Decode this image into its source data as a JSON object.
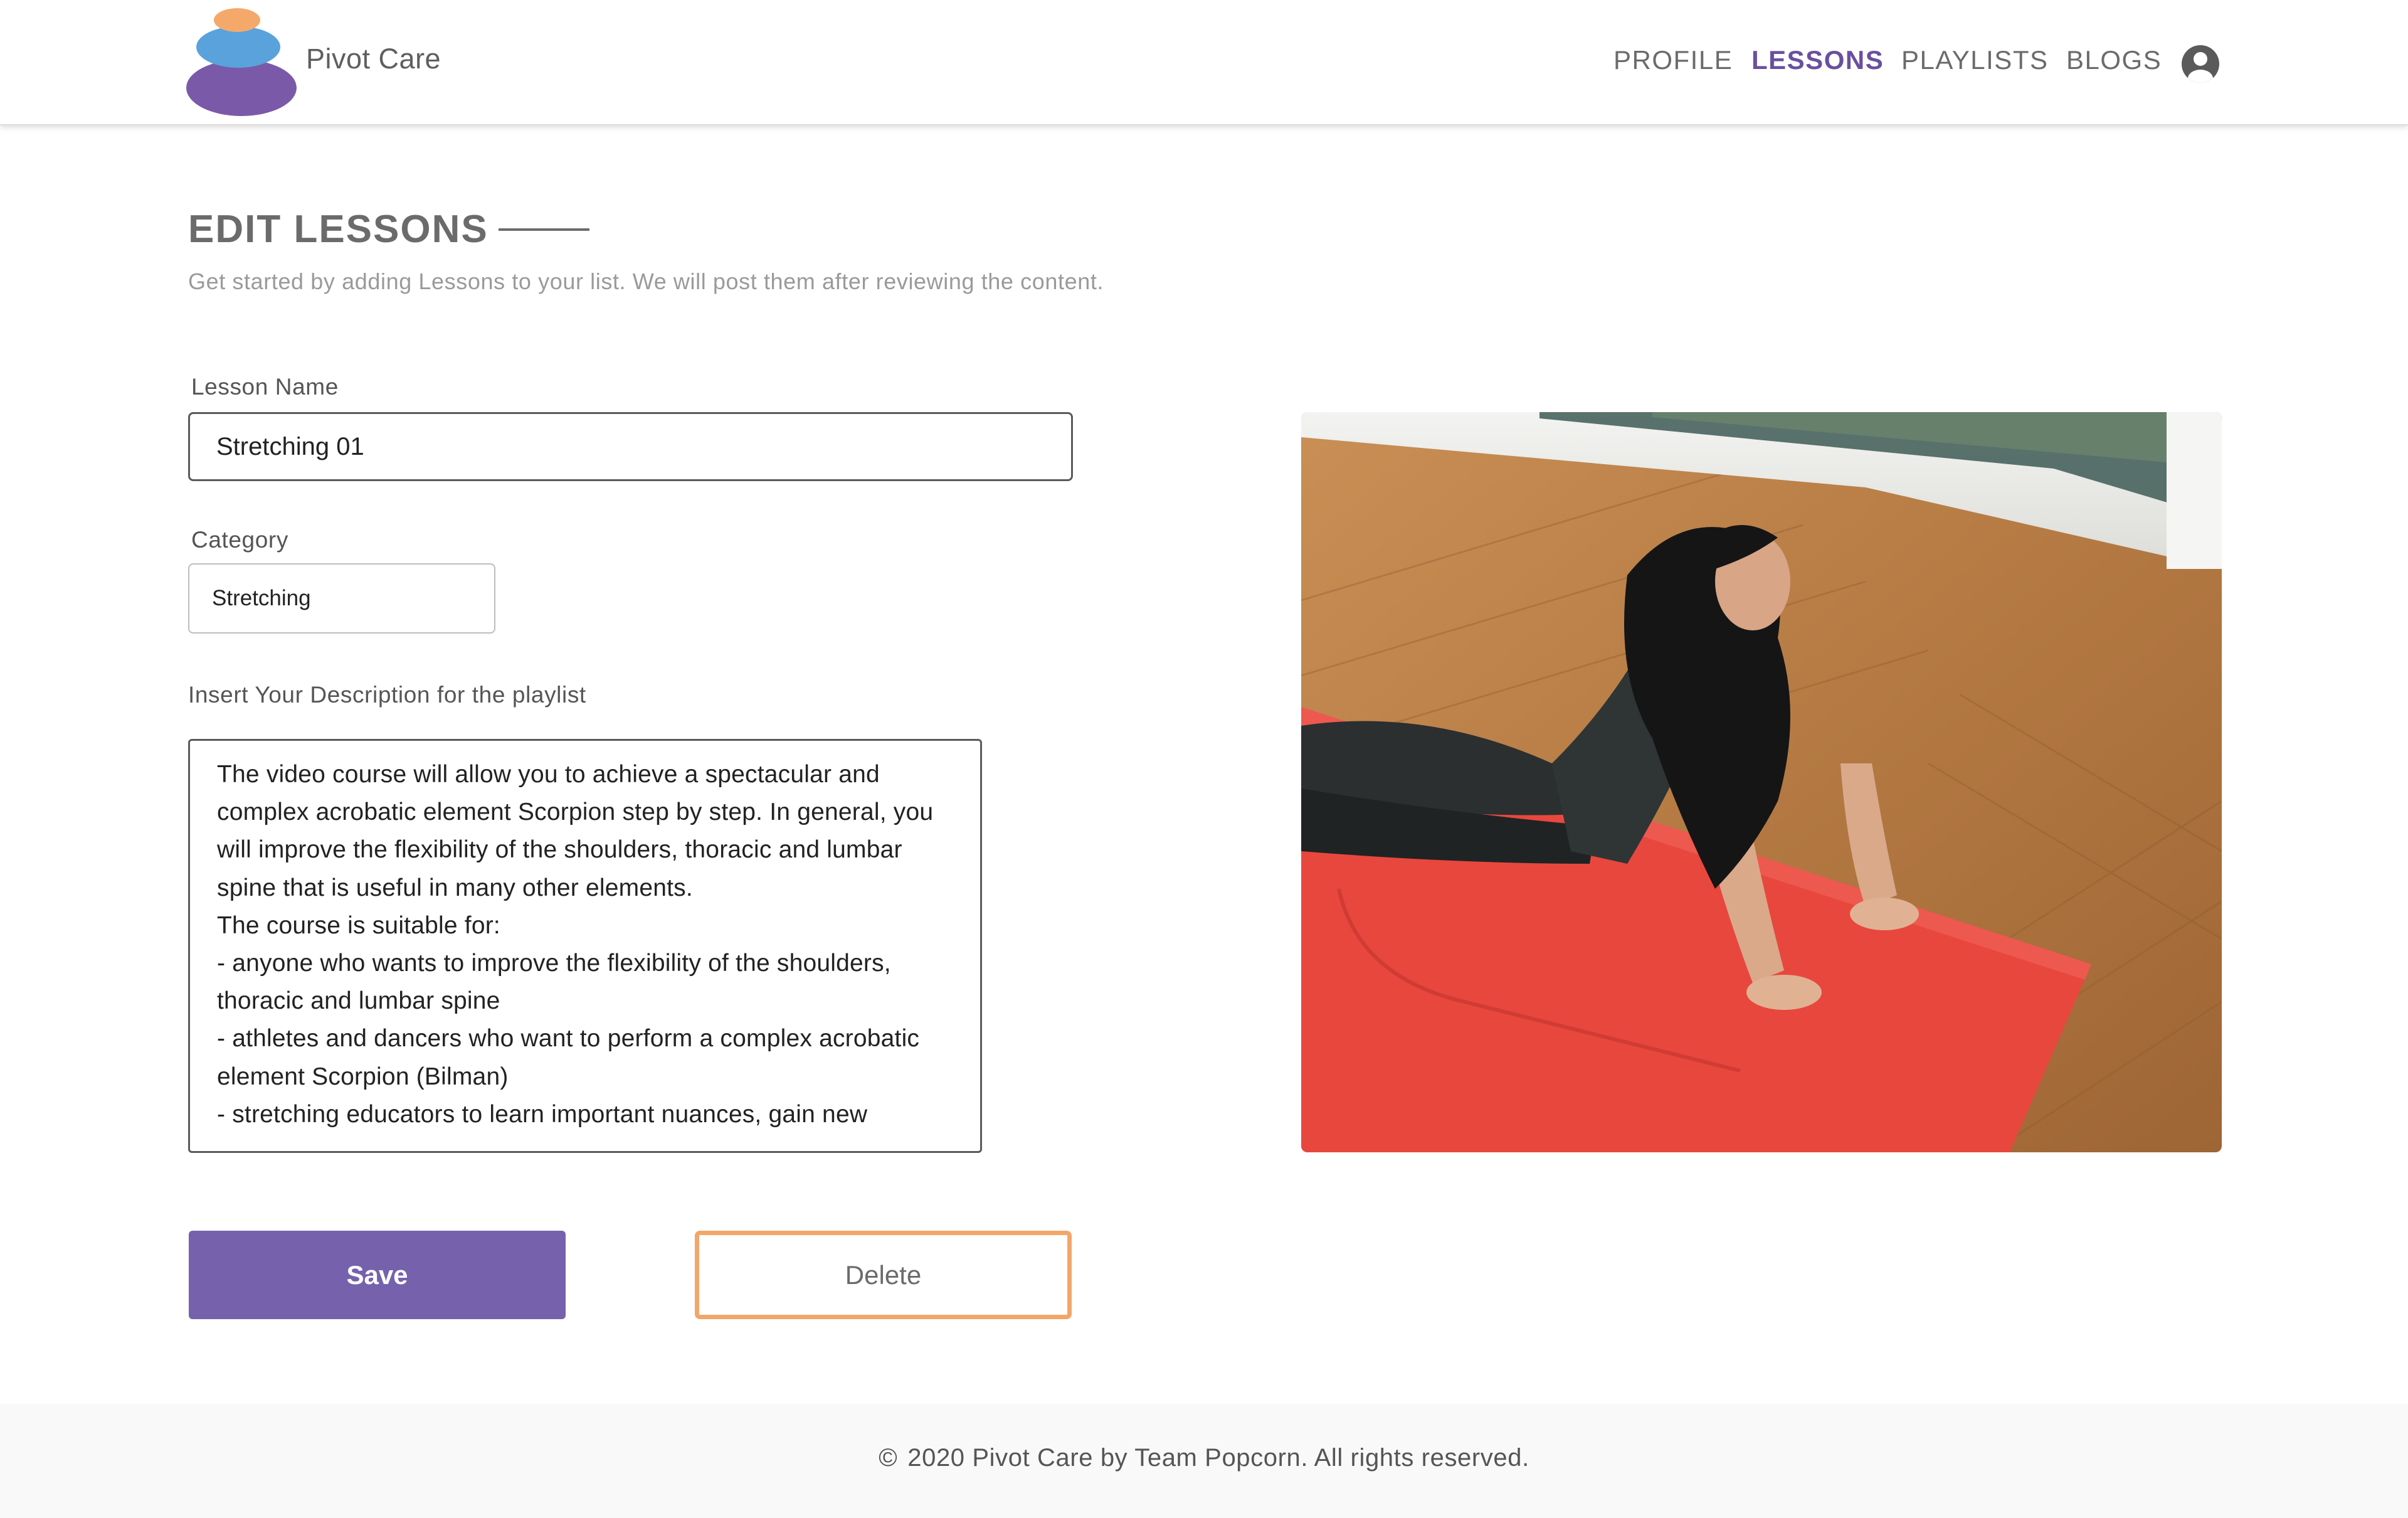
{
  "brand": {
    "name": "Pivot Care",
    "logo_icon": "stacked-stones-logo"
  },
  "nav": {
    "items": [
      {
        "label": "PROFILE",
        "active": false
      },
      {
        "label": "LESSONS",
        "active": true
      },
      {
        "label": "PLAYLISTS",
        "active": false
      },
      {
        "label": "BLOGS",
        "active": false
      }
    ],
    "account_icon": "account-circle-icon"
  },
  "page": {
    "title": "EDIT LESSONS",
    "subtitle": "Get started by adding Lessons to your list. We will post them after reviewing the content."
  },
  "form": {
    "lesson_name": {
      "label": "Lesson Name",
      "value": "Stretching 01"
    },
    "category": {
      "label": "Category",
      "value": "Stretching"
    },
    "description": {
      "label": "Insert Your Description for the playlist",
      "lines": [
        "The video course will allow you to achieve a spectacular and",
        "complex acrobatic element Scorpion step by step. In general, you",
        "will improve the flexibility of the shoulders, thoracic and lumbar",
        "spine that is useful in many other elements.",
        "The course is suitable for:",
        "- anyone who wants to improve the flexibility of the shoulders,",
        "thoracic and lumbar spine",
        "- athletes and dancers who want to perform a complex acrobatic",
        "element Scorpion (Bilman)",
        "- stretching educators to learn important nuances, gain new"
      ]
    }
  },
  "actions": {
    "save_label": "Save",
    "delete_label": "Delete"
  },
  "footer": {
    "text": "2020 Pivot Care by Team Popcorn. All rights reserved.",
    "copyright_symbol": "©"
  },
  "colors": {
    "accent": "#7661ad",
    "nav_active": "#6a4fa0",
    "delete_border": "#f2a66a",
    "logo_orange": "#f4a96b",
    "logo_blue": "#5aa2dc",
    "logo_purple": "#7a5aa8"
  }
}
